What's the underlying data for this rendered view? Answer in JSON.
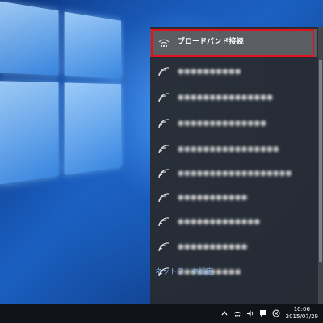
{
  "desktop": {
    "accent": "#1a5fc0"
  },
  "network_flyout": {
    "connected": {
      "label": "ブロードバンド接続",
      "icon": "dialup-connection-icon"
    },
    "networks": [
      {
        "label": "●●●●●●●●●●",
        "icon": "wifi-icon"
      },
      {
        "label": "●●●●●●●●●●●●●●●",
        "icon": "wifi-icon"
      },
      {
        "label": "●●●●●●●●●●●●●●",
        "icon": "wifi-icon"
      },
      {
        "label": "●●●●●●●●●●●●●●●●",
        "icon": "wifi-icon"
      },
      {
        "label": "●●●●●●●●●●●●●●●●●●",
        "icon": "wifi-icon"
      },
      {
        "label": "●●●●●●●●●●●",
        "icon": "wifi-icon"
      },
      {
        "label": "●●●●●●●●●●●●●",
        "icon": "wifi-icon"
      },
      {
        "label": "●●●●●●●●●●●",
        "icon": "wifi-icon"
      },
      {
        "label": "●●●●●●●●●●",
        "icon": "wifi-icon"
      }
    ],
    "settings_link": "ネットワーク設定",
    "highlight_color": "#e3111b"
  },
  "taskbar": {
    "clock": {
      "time": "10:06",
      "date": "2015/07/29"
    },
    "tray_icons": [
      "chevron-up-icon",
      "network-icon",
      "volume-icon",
      "action-center-icon",
      "close-circle-icon"
    ]
  }
}
